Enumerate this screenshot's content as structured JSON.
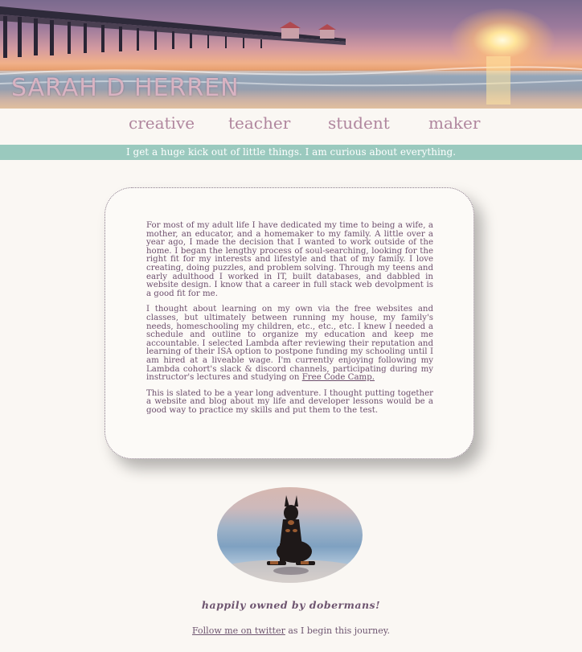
{
  "header": {
    "name": "SARAH D HERREN"
  },
  "nav": {
    "items": [
      {
        "label": "creative"
      },
      {
        "label": "teacher"
      },
      {
        "label": "student"
      },
      {
        "label": "maker"
      }
    ]
  },
  "tagline": "I get a huge kick out of little things. I am curious about everything.",
  "bio": {
    "p1": "For most of my adult life I have dedicated my time to being a wife, a mother, an educator, and a homemaker to my family. A little over a year ago, I made the decision that I wanted to work outside of the home. I began the lengthy process of soul-searching, looking for the right fit for my interests and lifestyle and that of my family. I love creating, doing puzzles, and problem solving. Through my teens and early adulthood I worked in IT, built databases, and dabbled in website design. I know that a career in full stack web devolpment is a good fit for me.",
    "p2_text": "I thought about learning on my own via the free websites and classes, but ultimately between running my house, my family's needs, homeschooling my children, etc., etc., etc. I knew I needed a schedule and outline to organize my education and keep me accountable. I selected Lambda after reviewing their reputation and learning of their ISA option to postpone funding my schooling until I am hired at a liveable wage. I'm currently enjoying following my Lambda cohort's slack & discord channels, participating during my instructor's lectures and studying on ",
    "p2_link": "Free Code Camp.",
    "p3": "This is slated to be a year long adventure. I thought putting together a website and blog about my life and developer lessons would be a good way to practice my skills and put them to the test."
  },
  "photo": {
    "icon": "doberman-on-beach"
  },
  "footer": {
    "owned": "happily owned by dobermans!",
    "follow_link": "Follow me on twitter",
    "follow_rest": " as I begin this journey."
  },
  "colors": {
    "background": "#faf7f3",
    "tagline_bar": "#9ac9be",
    "nav_text": "#b0869e",
    "body_text": "#6d4f6d"
  }
}
